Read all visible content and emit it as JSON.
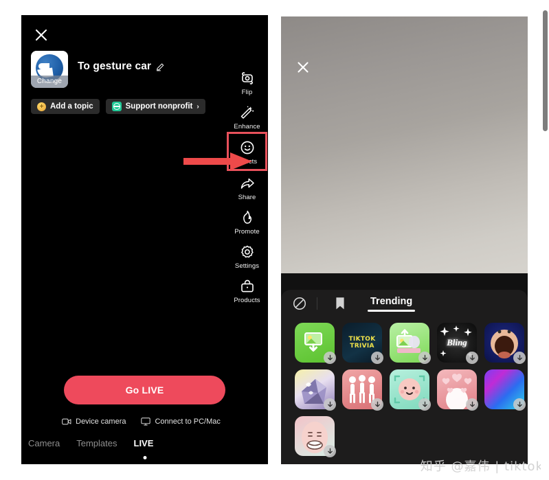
{
  "left_panel": {
    "close_icon": "close-icon",
    "avatar": {
      "change_label": "Change",
      "icon": "profile-avatar"
    },
    "title": "To gesture car",
    "edit_icon": "pencil-edit-icon",
    "chips": [
      {
        "label": "Add a topic",
        "icon": "plus-badge-icon",
        "chevron": ""
      },
      {
        "label": "Support nonprofit",
        "icon": "globe-icon",
        "chevron": "›"
      }
    ],
    "rail": [
      {
        "label": "Flip",
        "icon": "flip-camera-icon",
        "highlighted": false
      },
      {
        "label": "Enhance",
        "icon": "magic-wand-icon",
        "highlighted": false
      },
      {
        "label": "Effects",
        "icon": "smiley-face-icon",
        "highlighted": true
      },
      {
        "label": "Share",
        "icon": "share-arrow-icon",
        "highlighted": false
      },
      {
        "label": "Promote",
        "icon": "flame-icon",
        "highlighted": false
      },
      {
        "label": "Settings",
        "icon": "gear-icon",
        "highlighted": false
      },
      {
        "label": "Products",
        "icon": "shopping-bag-icon",
        "highlighted": false
      }
    ],
    "go_live_label": "Go LIVE",
    "sources": [
      {
        "label": "Device camera",
        "icon": "camera-icon"
      },
      {
        "label": "Connect to PC/Mac",
        "icon": "monitor-icon"
      }
    ],
    "tabs": [
      {
        "label": "Camera",
        "active": false
      },
      {
        "label": "Templates",
        "active": false
      },
      {
        "label": "LIVE",
        "active": true
      }
    ]
  },
  "right_panel": {
    "close_icon": "close-icon",
    "tray": {
      "no_effect_icon": "no-effect-icon",
      "bookmark_icon": "bookmark-icon",
      "active_tab": "Trending",
      "effects": [
        {
          "name": "green-photo-download",
          "art": "t-green",
          "glyph": "⬇",
          "label": ""
        },
        {
          "name": "tiktok-trivia",
          "art": "t-trivia",
          "glyph": "",
          "label": "TIKTOK\nTRIVIA"
        },
        {
          "name": "mint-photo-upload",
          "art": "t-mint",
          "glyph": "",
          "label": ""
        },
        {
          "name": "bling",
          "art": "t-bling",
          "glyph": "",
          "label": "Bling"
        },
        {
          "name": "wide-mouth-face",
          "art": "t-face1",
          "glyph": "",
          "label": ""
        },
        {
          "name": "lavender-crystal",
          "art": "t-lav",
          "glyph": "",
          "label": ""
        },
        {
          "name": "three-dancers",
          "art": "t-pink",
          "glyph": "",
          "label": ""
        },
        {
          "name": "cute-green-face",
          "art": "t-teal",
          "glyph": "",
          "label": ""
        },
        {
          "name": "hearts-bubble",
          "art": "t-heart",
          "glyph": "",
          "label": ""
        },
        {
          "name": "neon-gradient",
          "art": "t-grad",
          "glyph": "",
          "label": ""
        },
        {
          "name": "egg-face",
          "art": "t-egg",
          "glyph": "",
          "label": ""
        }
      ]
    }
  },
  "annotations": {
    "arrow": {
      "name": "red-pointer-arrow",
      "color": "#ee4a4a",
      "points_to": "Effects"
    },
    "highlight_color": "#e8515b"
  },
  "watermark": "知乎 @嘉伟 | tiktok",
  "colors": {
    "accent_red": "#ee4a5c",
    "panel_black": "#000000",
    "tray_bg": "#1d1c1c"
  }
}
